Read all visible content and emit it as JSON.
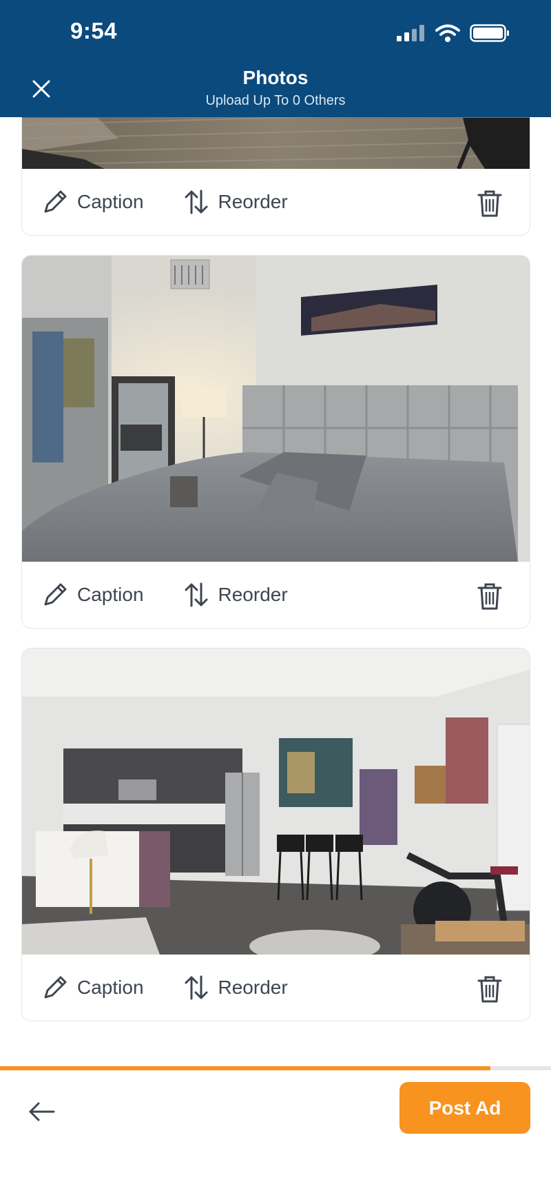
{
  "status_bar": {
    "time": "9:54"
  },
  "header": {
    "title": "Photos",
    "subtitle": "Upload Up To 0 Others"
  },
  "photos": [
    {
      "scene": "living room floor (partial)",
      "caption_label": "Caption",
      "reorder_label": "Reorder"
    },
    {
      "scene": "bedroom with upholstered headboard",
      "caption_label": "Caption",
      "reorder_label": "Reorder"
    },
    {
      "scene": "open kitchen and living area",
      "caption_label": "Caption",
      "reorder_label": "Reorder"
    }
  ],
  "footer": {
    "post_label": "Post Ad",
    "progress": 0.89
  },
  "colors": {
    "header_bg": "#0b4a7d",
    "accent": "#f7931e",
    "icon": "#3d4550"
  },
  "icons": [
    "close-icon",
    "signal-icon",
    "wifi-icon",
    "battery-icon",
    "pencil-icon",
    "reorder-arrows-icon",
    "trash-icon",
    "back-arrow-icon"
  ]
}
